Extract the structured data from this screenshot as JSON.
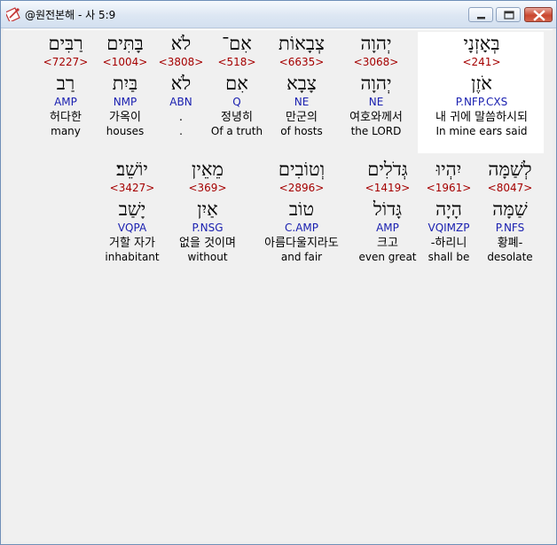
{
  "window": {
    "title": "@원전본해 - 사 5:9"
  },
  "colors": {
    "strong": "#a50000",
    "morph": "#1a20b0",
    "highlight": "#ffffff"
  },
  "words": [
    {
      "heb": "בְּאָזְנָי",
      "strong": "<241>",
      "lemma": "אֹזֶן",
      "morph": "P.NFP.CXS",
      "kor": "내 귀에 말씀하시되",
      "eng": "In mine ears said",
      "highlighted": true
    },
    {
      "heb": "יְהוָה",
      "strong": "<3068>",
      "lemma": "יְהוָה",
      "morph": "NE",
      "kor": "여호와께서",
      "eng": "the LORD"
    },
    {
      "heb": "צְבָאוֹת",
      "strong": "<6635>",
      "lemma": "צָבָא",
      "morph": "NE",
      "kor": "만군의",
      "eng": "of hosts"
    },
    {
      "heb": "אִם־",
      "strong": "<518>",
      "lemma": "אִם",
      "morph": "Q",
      "kor": "정녕히",
      "eng": "Of a truth"
    },
    {
      "heb": "לֹא",
      "strong": "<3808>",
      "lemma": "לֹא",
      "morph": "ABN",
      "kor": ".",
      "eng": "."
    },
    {
      "heb": "בָּתִּים",
      "strong": "<1004>",
      "lemma": "בַּיִת",
      "morph": "NMP",
      "kor": "가옥이",
      "eng": "houses"
    },
    {
      "heb": "רַבִּים",
      "strong": "<7227>",
      "lemma": "רַב",
      "morph": "AMP",
      "kor": "허다한",
      "eng": "many"
    },
    {
      "heb": "לְשַׁמָּה",
      "strong": "<8047>",
      "lemma": "שַׁמָּה",
      "morph": "P.NFS",
      "kor": "황폐-",
      "eng": "desolate"
    },
    {
      "heb": "יִהְיוּ",
      "strong": "<1961>",
      "lemma": "הָיָה",
      "morph": "VQIMZP",
      "kor": "-하리니",
      "eng": "shall be"
    },
    {
      "heb": "גְּדֹלִים",
      "strong": "<1419>",
      "lemma": "גָּדוֹל",
      "morph": "AMP",
      "kor": "크고",
      "eng": "even great"
    },
    {
      "heb": "וְטוֹבִים",
      "strong": "<2896>",
      "lemma": "טוֹב",
      "morph": "C.AMP",
      "kor": "아름다울지라도",
      "eng": "and fair"
    },
    {
      "heb": "מֵאֵין",
      "strong": "<369>",
      "lemma": "אַיִן",
      "morph": "P.NSG",
      "kor": "없을 것이며",
      "eng": "without"
    },
    {
      "heb": "יוֹשֵׁב׃",
      "strong": "<3427>",
      "lemma": "יָשַׁב",
      "morph": "VQPA",
      "kor": "거할 자가",
      "eng": "inhabitant"
    }
  ]
}
